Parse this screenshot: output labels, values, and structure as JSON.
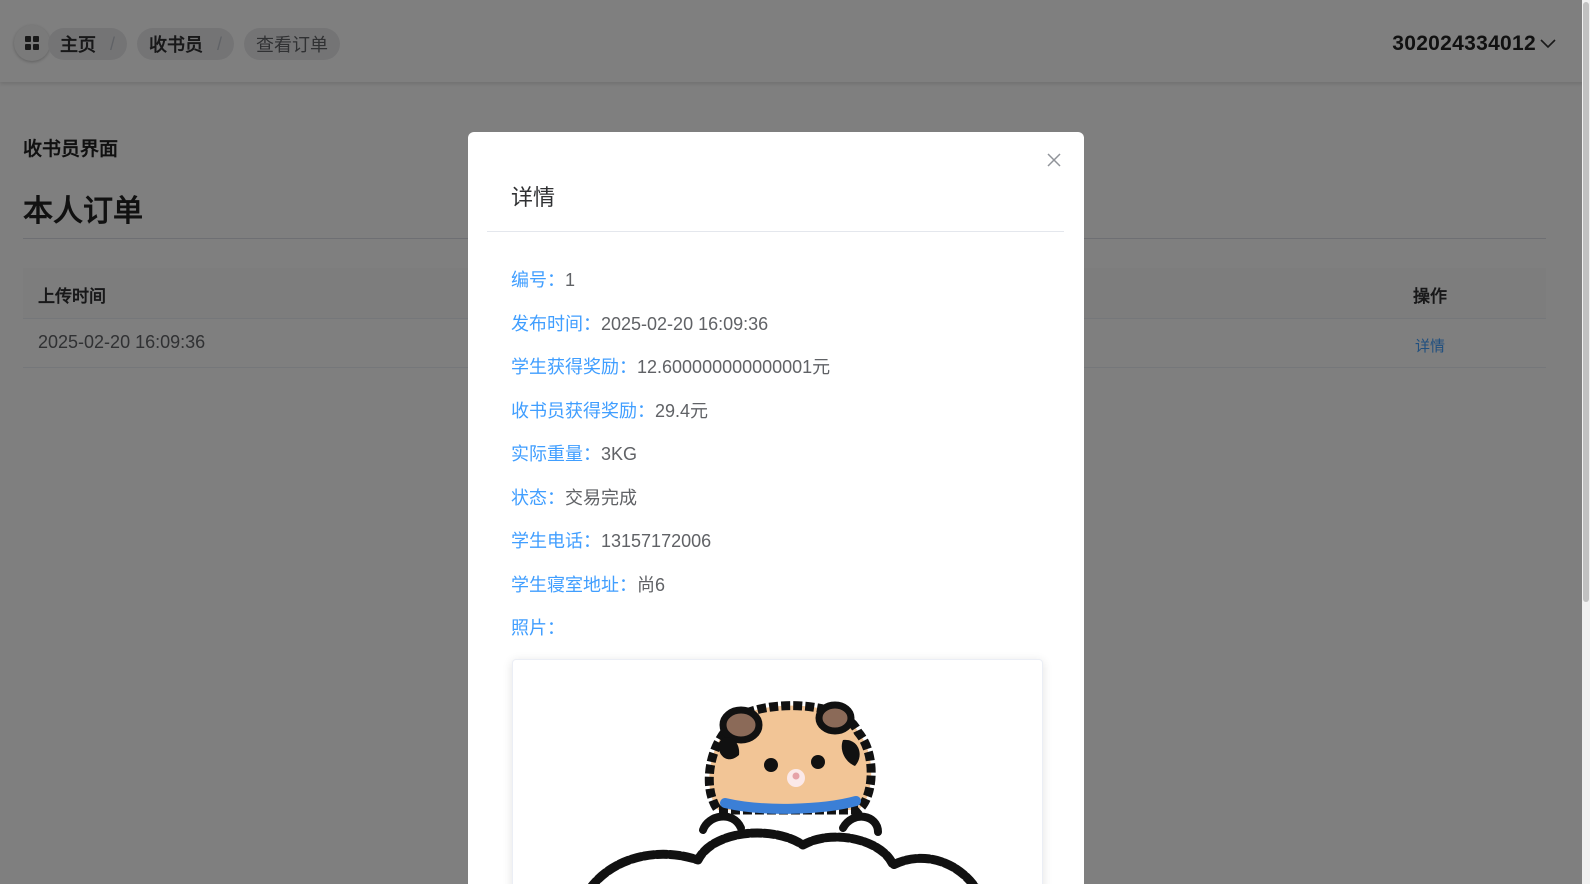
{
  "header": {
    "breadcrumbs": [
      {
        "label": "主页",
        "separator": "/"
      },
      {
        "label": "收书员",
        "separator": "/"
      },
      {
        "label": "查看订单"
      }
    ],
    "username": "302024334012",
    "menu_icon": "grid-icon",
    "dropdown_icon": "chevron-down-icon"
  },
  "main": {
    "section_label": "收书员界面",
    "title": "本人订单",
    "table": {
      "columns": [
        "上传时间",
        "操作"
      ],
      "rows": [
        {
          "upload_time": "2025-02-20 16:09:36",
          "action": "详情"
        }
      ]
    }
  },
  "dialog": {
    "title": "详情",
    "close_icon": "close-icon",
    "fields": [
      {
        "key": "编号：",
        "value": "1"
      },
      {
        "key": "发布时间：",
        "value": "2025-02-20 16:09:36"
      },
      {
        "key": "学生获得奖励：",
        "value": "12.600000000000001元"
      },
      {
        "key": "收书员获得奖励：",
        "value": "29.4元"
      },
      {
        "key": "实际重量：",
        "value": "3KG"
      },
      {
        "key": "状态：",
        "value": "交易完成"
      },
      {
        "key": "学生电话：",
        "value": "13157172006"
      },
      {
        "key": "学生寝室地址：",
        "value": "尚6"
      },
      {
        "key": "照片：",
        "value": ""
      }
    ],
    "photo": "hamster-drawing-image"
  },
  "colors": {
    "accent": "#409eff",
    "overlay": "rgba(0,0,0,0.5)",
    "text_primary": "#303133",
    "text_secondary": "#606266"
  }
}
